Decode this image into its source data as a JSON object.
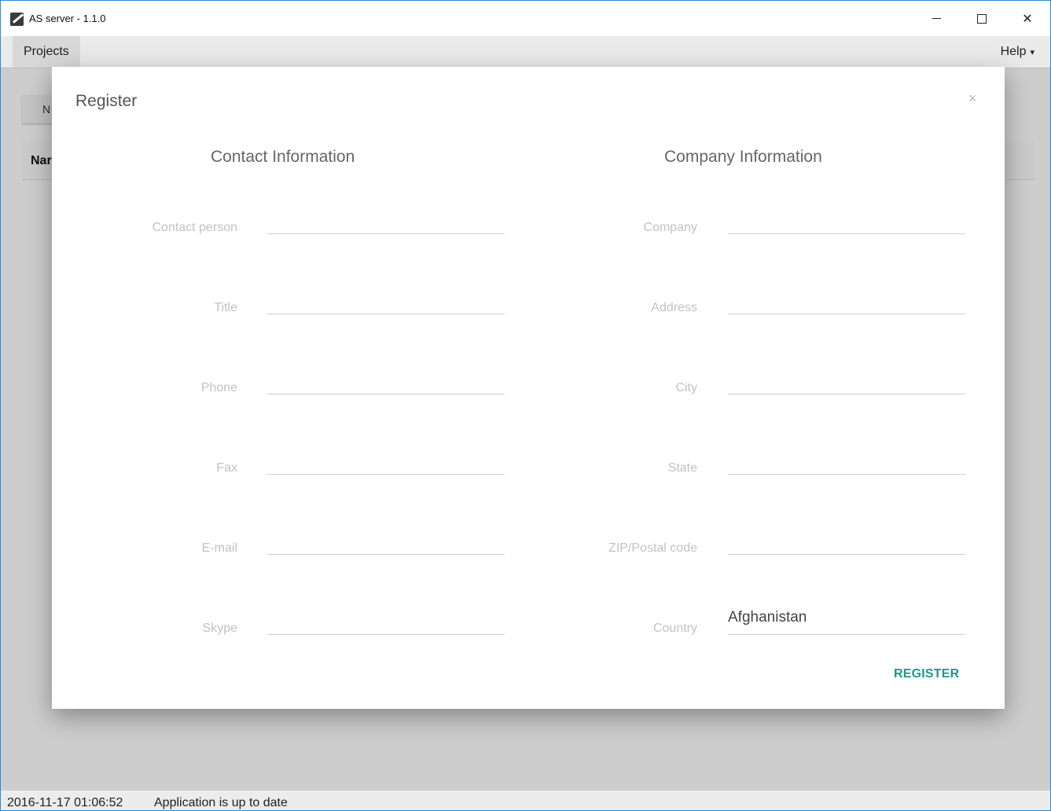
{
  "window": {
    "title": "AS server - 1.1.0",
    "controls": {
      "minimize": "minimize",
      "maximize": "maximize",
      "close": "✕"
    }
  },
  "menu": {
    "projects": "Projects",
    "help": "Help",
    "help_caret": "▾"
  },
  "background": {
    "button_partial": "N",
    "table_header_partial": "Nar"
  },
  "modal": {
    "title": "Register",
    "close": "×",
    "contact_section": "Contact Information",
    "company_section": "Company Information",
    "contact_fields": [
      {
        "label": "Contact person",
        "value": ""
      },
      {
        "label": "Title",
        "value": ""
      },
      {
        "label": "Phone",
        "value": ""
      },
      {
        "label": "Fax",
        "value": ""
      },
      {
        "label": "E-mail",
        "value": ""
      },
      {
        "label": "Skype",
        "value": ""
      }
    ],
    "company_fields": [
      {
        "label": "Company",
        "value": ""
      },
      {
        "label": "Address",
        "value": ""
      },
      {
        "label": "City",
        "value": ""
      },
      {
        "label": "State",
        "value": ""
      },
      {
        "label": "ZIP/Postal code",
        "value": ""
      },
      {
        "label": "Country",
        "value": "Afghanistan"
      }
    ],
    "register_button": "REGISTER"
  },
  "status": {
    "timestamp": "2016-11-17 01:06:52",
    "message": "Application is up to date"
  },
  "colors": {
    "accent": "#1a9a8c",
    "window_border": "#2b8ad6"
  }
}
